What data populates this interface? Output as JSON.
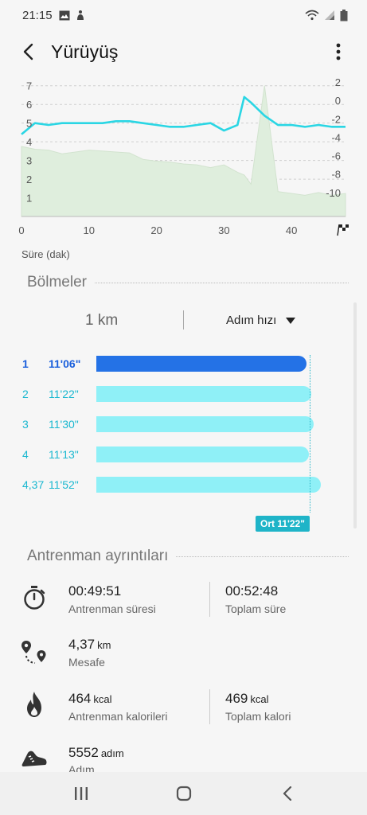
{
  "status_bar": {
    "time": "21:15",
    "icons": [
      "image-icon",
      "accessibility-icon",
      "wifi-icon",
      "signal-icon",
      "battery-icon"
    ]
  },
  "app_bar": {
    "title": "Yürüyüş",
    "back_icon": "back-arrow-icon",
    "more_icon": "more-vert-icon"
  },
  "chart": {
    "left_axis_ticks": [
      "7",
      "6",
      "5",
      "4",
      "3",
      "2",
      "1"
    ],
    "right_axis_ticks": [
      "2",
      "0",
      "-2",
      "-4",
      "-6",
      "-8",
      "-10"
    ],
    "x_ticks": [
      "0",
      "10",
      "20",
      "30",
      "40"
    ],
    "finish_icon": "checkered-flag-icon",
    "x_axis_label": "Süre (dak)",
    "line_color": "#2ad6e4",
    "area_color": "#dfeedd"
  },
  "chart_data": {
    "type": "line",
    "x": [
      0,
      2,
      4,
      6,
      8,
      10,
      12,
      14,
      16,
      18,
      20,
      22,
      24,
      26,
      28,
      30,
      32,
      33,
      34,
      36,
      38,
      40,
      42,
      44,
      46,
      48
    ],
    "series": [
      {
        "values": [
          4.4,
          5.0,
          4.9,
          5.0,
          5.0,
          5.0,
          5.0,
          5.1,
          5.1,
          5.0,
          4.9,
          4.8,
          4.8,
          4.9,
          5.0,
          4.6,
          4.9,
          6.4,
          6.1,
          5.4,
          4.9,
          4.9,
          4.8,
          4.9,
          4.8,
          4.8
        ]
      },
      {
        "values": [
          -5.0,
          -5.3,
          -5.4,
          -5.8,
          -5.6,
          -5.4,
          -5.5,
          -5.6,
          -5.7,
          -6.4,
          -6.6,
          -6.7,
          -6.9,
          -7.0,
          -7.3,
          -7.0,
          -7.8,
          -8.1,
          -9.1,
          1.6,
          -9.9,
          -10.1,
          -10.3,
          -10.0,
          -10.3,
          -10.1
        ]
      }
    ],
    "xlim": [
      0,
      48
    ],
    "ylim": [
      0,
      7.5
    ],
    "y2lim": [
      -12.6,
      2.6
    ],
    "xlabel": "Süre (dak)",
    "grid": true
  },
  "splits": {
    "section_title": "Bölmeler",
    "unit": "1 km",
    "metric": "Adım hızı",
    "max_pace_seconds": 712,
    "rows": [
      {
        "index": "1",
        "pace": "11'06\"",
        "seconds": 666,
        "best": true
      },
      {
        "index": "2",
        "pace": "11'22\"",
        "seconds": 682,
        "best": false
      },
      {
        "index": "3",
        "pace": "11'30\"",
        "seconds": 690,
        "best": false
      },
      {
        "index": "4",
        "pace": "11'13\"",
        "seconds": 673,
        "best": false
      },
      {
        "index": "4,37",
        "pace": "11'52\"",
        "seconds": 712,
        "best": false
      }
    ],
    "average_label": "Ort 11'22\""
  },
  "details": {
    "section_title": "Antrenman ayrıntıları",
    "workout_duration": {
      "value": "00:49:51",
      "label": "Antrenman süresi",
      "icon": "stopwatch-icon"
    },
    "total_duration": {
      "value": "00:52:48",
      "label": "Toplam süre"
    },
    "distance": {
      "value": "4,37",
      "unit": "km",
      "label": "Mesafe",
      "icon": "route-icon"
    },
    "workout_calories": {
      "value": "464",
      "unit": "kcal",
      "label": "Antrenman kalorileri",
      "icon": "flame-icon"
    },
    "total_calories": {
      "value": "469",
      "unit": "kcal",
      "label": "Toplam kalori"
    },
    "steps": {
      "value": "5552",
      "unit": "adım",
      "label": "Adım",
      "icon": "shoe-icon"
    }
  },
  "nav_bar": {
    "buttons": [
      "recents-icon",
      "home-icon",
      "back-icon"
    ]
  }
}
